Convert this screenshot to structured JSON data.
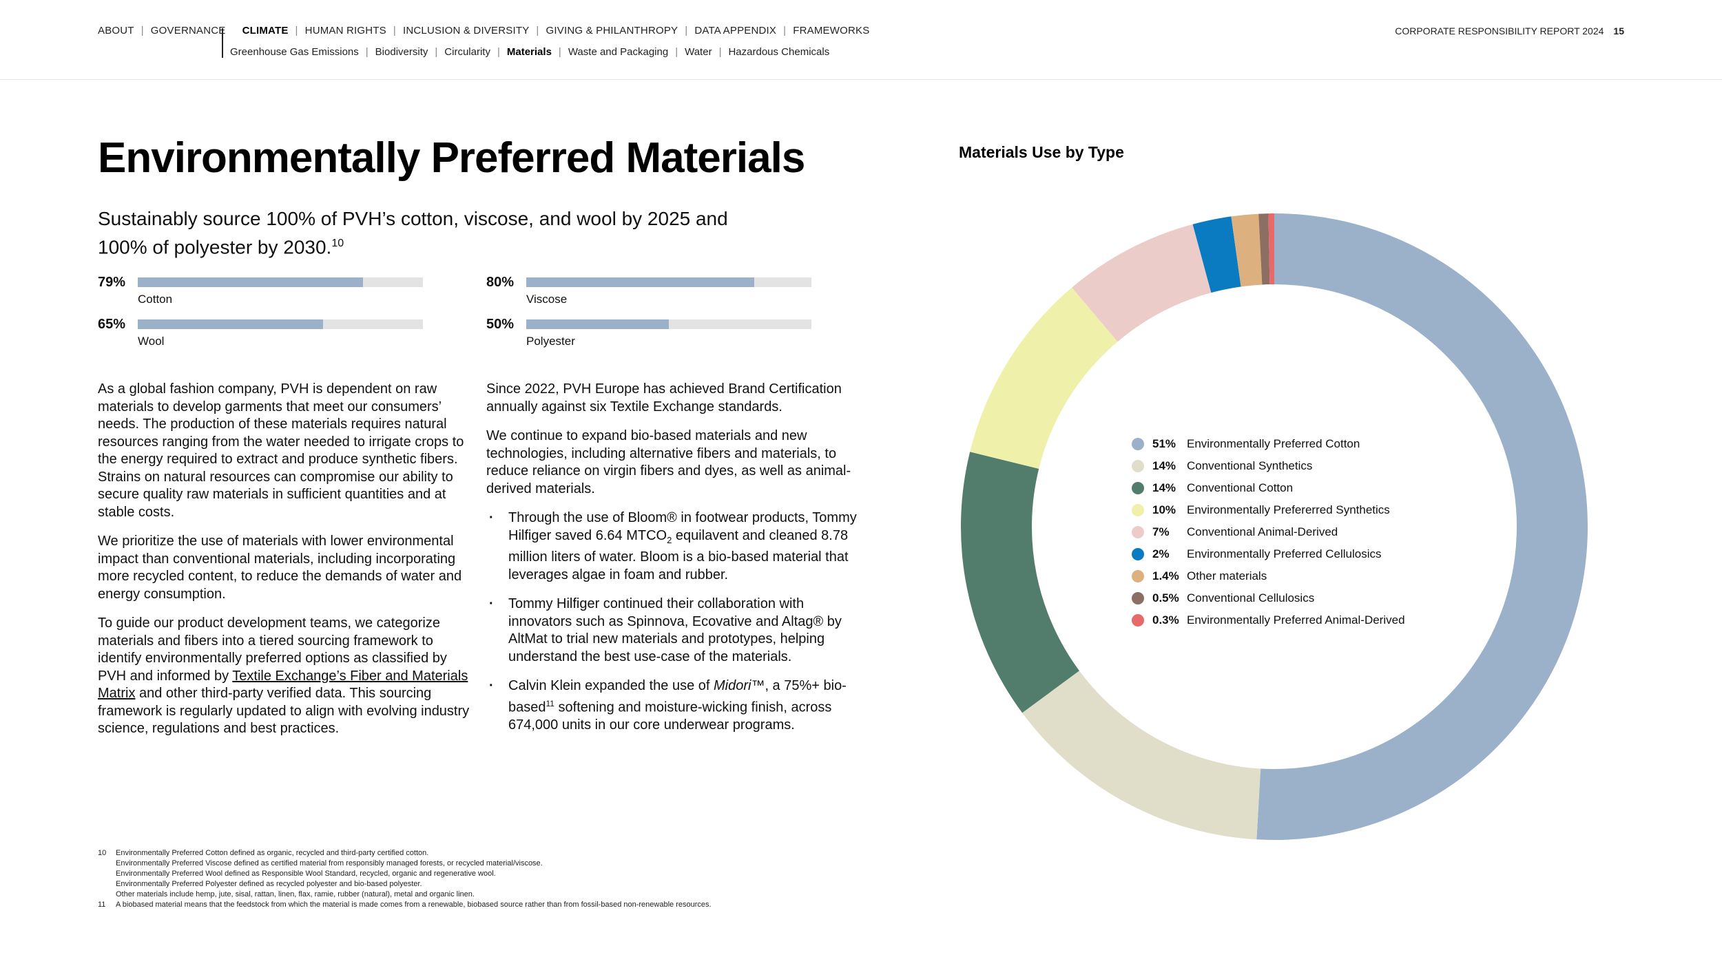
{
  "nav": {
    "items": [
      "ABOUT",
      "GOVERNANCE",
      "CLIMATE",
      "HUMAN RIGHTS",
      "INCLUSION & DIVERSITY",
      "GIVING & PHILANTHROPY",
      "DATA APPENDIX",
      "FRAMEWORKS"
    ],
    "sub_items": [
      "Greenhouse Gas Emissions",
      "Biodiversity",
      "Circularity",
      "Materials",
      "Waste and Packaging",
      "Water",
      "Hazardous Chemicals"
    ],
    "report_label": "CORPORATE RESPONSIBILITY REPORT 2024",
    "page_number": "15"
  },
  "title": "Environmentally Preferred Materials",
  "goal": {
    "text": "Sustainably source 100% of PVH’s cotton, viscose, and wool by 2025 and 100% of polyester by 2030.",
    "footnote_ref": "10"
  },
  "progress": [
    {
      "label": "Cotton",
      "pct_text": "79%",
      "value": 0.79
    },
    {
      "label": "Viscose",
      "pct_text": "80%",
      "value": 0.8
    },
    {
      "label": "Wool",
      "pct_text": "65%",
      "value": 0.65
    },
    {
      "label": "Polyester",
      "pct_text": "50%",
      "value": 0.5
    }
  ],
  "left_col": {
    "p1": "As a global fashion company, PVH is dependent on raw materials to develop garments that meet our consumers’ needs. The production of these materials requires natural resources ranging from the water needed to irrigate crops to the energy required to extract and produce synthetic fibers. Strains on natural resources can compromise our ability to secure quality raw materials in sufficient quantities and at stable costs.",
    "p2": "We prioritize the use of materials with lower environmental impact than conventional materials, including incorporating more recycled content, to reduce the demands of water and energy consumption.",
    "p3_before": "To guide our product development teams, we categorize materials and fibers into a tiered sourcing framework to identify environmentally preferred options as classified by PVH and informed by ",
    "p3_link": "Textile Exchange’s Fiber and Materials Matrix",
    "p3_after": " and other third-party verified data. This sourcing framework is regularly updated to align with evolving industry science, regulations and best practices."
  },
  "right_col": {
    "p1": "Since 2022, PVH Europe has achieved Brand Certification annually against six Textile Exchange standards.",
    "p2": "We continue to expand bio-based materials and new technologies, including alternative fibers and materials, to reduce reliance on virgin fibers and dyes, as well as animal-derived materials.",
    "b1_a": "Through the use of Bloom® in footwear products, Tommy Hilfiger saved 6.64 MTCO",
    "b1_sub": "2",
    "b1_b": " equilavent and cleaned 8.78 million liters of water. Bloom is a bio-based material that leverages algae in foam and rubber.",
    "b2": "Tommy Hilfiger continued their collaboration with innovators such as Spinnova, Ecovative and Altag® by AltMat to trial new materials and prototypes, helping understand the best use-case of the materials.",
    "b3_a": "Calvin Klein expanded the use of ",
    "b3_em": "Midori",
    "b3_b": "™, a 75%+ bio-based",
    "b3_sup": "11",
    "b3_c": " softening and moisture-wicking finish, across 674,000 units in our core underwear programs."
  },
  "footnotes": [
    {
      "num": "10",
      "text": "Environmentally Preferred Cotton defined as organic, recycled and third-party certified cotton.\nEnvironmentally Preferred Viscose defined as certified material from responsibly managed forests, or recycled material/viscose.\nEnvironmentally Preferred Wool defined as Responsible Wool Standard, recycled, organic and regenerative wool.\nEnvironmentally Preferred Polyester defined as recycled polyester and bio-based polyester.\nOther materials include hemp, jute, sisal, rattan, linen, flax, ramie, rubber (natural), metal and organic linen."
    },
    {
      "num": "11",
      "text": "A biobased material means that the feedstock from which the material is made comes from a renewable, biobased source rather than from fossil-based non-renewable resources."
    }
  ],
  "chart_data": {
    "type": "pie",
    "title": "Materials Use by Type",
    "donut": true,
    "legend_position": "center",
    "slices": [
      {
        "label": "Environmentally Preferred Cotton",
        "value": 51,
        "value_text": "51%",
        "color": "#9bb0c9"
      },
      {
        "label": "Conventional Synthetics",
        "value": 14,
        "value_text": "14%",
        "color": "#e0dec9"
      },
      {
        "label": "Conventional Cotton",
        "value": 14,
        "value_text": "14%",
        "color": "#527c6b"
      },
      {
        "label": "Environmentally Prefererred Synthetics",
        "value": 10,
        "value_text": "10%",
        "color": "#eff0a9"
      },
      {
        "label": "Conventional Animal-Derived",
        "value": 7,
        "value_text": "7%",
        "color": "#ecccc9"
      },
      {
        "label": "Environmentally Preferred Cellulosics",
        "value": 2,
        "value_text": "2%",
        "color": "#0a7bc0"
      },
      {
        "label": "Other materials",
        "value": 1.4,
        "value_text": "1.4%",
        "color": "#dcb17f"
      },
      {
        "label": "Conventional Cellulosics",
        "value": 0.5,
        "value_text": "0.5%",
        "color": "#8c6e63"
      },
      {
        "label": "Environmentally Preferred Animal-Derived",
        "value": 0.3,
        "value_text": "0.3%",
        "color": "#e76a6a"
      }
    ]
  }
}
